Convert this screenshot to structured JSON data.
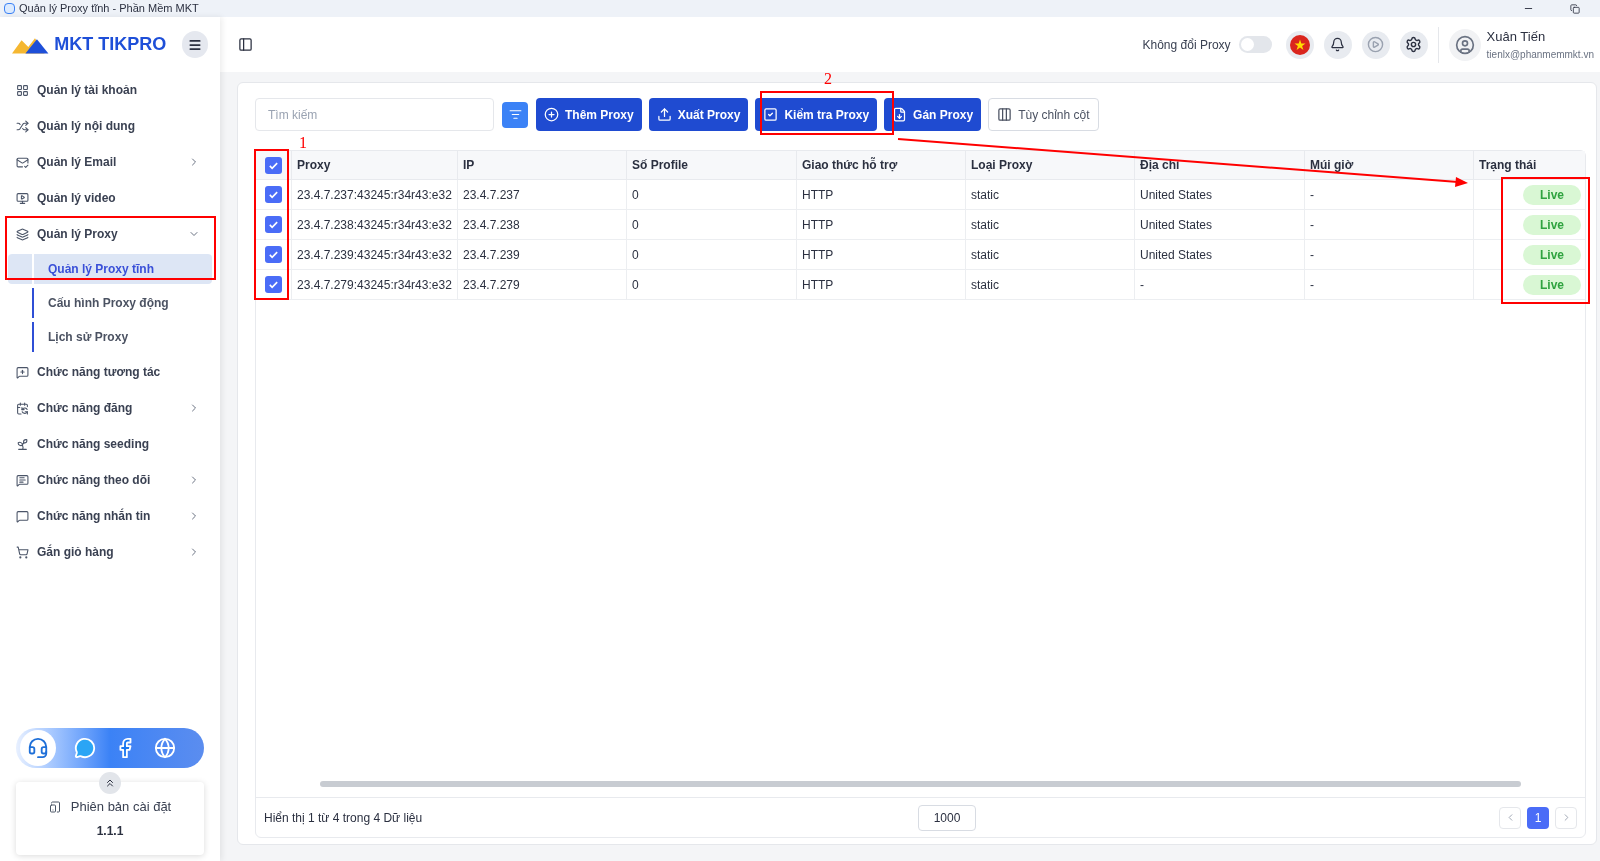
{
  "window": {
    "title": "Quản lý Proxy tĩnh - Phần Mềm MKT"
  },
  "sidebar": {
    "logo": "MKT TIKPRO",
    "items": [
      {
        "label": "Quản lý tài khoản",
        "kind": "link"
      },
      {
        "label": "Quản lý nội dung",
        "kind": "link"
      },
      {
        "label": "Quản lý Email",
        "kind": "group",
        "expanded": false
      },
      {
        "label": "Quản lý video",
        "kind": "link"
      },
      {
        "label": "Quản lý Proxy",
        "kind": "group",
        "expanded": true,
        "children": [
          {
            "label": "Quản lý Proxy tĩnh",
            "selected": true
          },
          {
            "label": "Cấu hình Proxy động",
            "selected": false
          },
          {
            "label": "Lịch sử Proxy",
            "selected": false
          }
        ]
      },
      {
        "label": "Chức năng tương tác",
        "kind": "link"
      },
      {
        "label": "Chức năng đăng",
        "kind": "group",
        "expanded": false
      },
      {
        "label": "Chức năng seeding",
        "kind": "link"
      },
      {
        "label": "Chức năng theo dõi",
        "kind": "group",
        "expanded": false
      },
      {
        "label": "Chức năng nhắn tin",
        "kind": "group",
        "expanded": false
      },
      {
        "label": "Gắn giỏ hàng",
        "kind": "group",
        "expanded": false
      }
    ],
    "version": {
      "label": "Phiên bản cài đặt",
      "value": "1.1.1"
    }
  },
  "header": {
    "toggle": {
      "label": "Không đổi Proxy",
      "on": false
    },
    "user": {
      "name": "Xuân Tiến",
      "email": "tienlx@phanmemmkt.vn"
    }
  },
  "toolbar": {
    "search": {
      "placeholder": "Tìm kiếm"
    },
    "buttons": [
      {
        "label": "Thêm Proxy",
        "kind": "primary"
      },
      {
        "label": "Xuất Proxy",
        "kind": "primary"
      },
      {
        "label": "Kiểm tra Proxy",
        "kind": "primary"
      },
      {
        "label": "Gán Proxy",
        "kind": "primary"
      },
      {
        "label": "Tùy chỉnh cột",
        "kind": "outline"
      }
    ]
  },
  "table": {
    "all_checked": true,
    "columns": [
      "Proxy",
      "IP",
      "Số Profile",
      "Giao thức hỗ trợ",
      "Loại Proxy",
      "Địa chỉ",
      "Múi giờ",
      "Trạng thái"
    ],
    "rows": [
      {
        "checked": true,
        "cells": [
          "23.4.7.237:43245:r34r43:e32",
          "23.4.7.237",
          "0",
          "HTTP",
          "static",
          "United States",
          "-"
        ],
        "status": "Live"
      },
      {
        "checked": true,
        "cells": [
          "23.4.7.238:43245:r34r43:e32",
          "23.4.7.238",
          "0",
          "HTTP",
          "static",
          "United States",
          "-"
        ],
        "status": "Live"
      },
      {
        "checked": true,
        "cells": [
          "23.4.7.239:43245:r34r43:e32",
          "23.4.7.239",
          "0",
          "HTTP",
          "static",
          "United States",
          "-"
        ],
        "status": "Live"
      },
      {
        "checked": true,
        "cells": [
          "23.4.7.279:43245:r34r43:e32",
          "23.4.7.279",
          "0",
          "HTTP",
          "static",
          "-",
          "-"
        ],
        "status": "Live"
      }
    ]
  },
  "footer": {
    "summary": "Hiển thị 1 từ 4 trong 4 Dữ liệu",
    "page_size": "1000",
    "pages": [
      {
        "label": "1",
        "selected": true
      }
    ]
  },
  "annotations": {
    "labels": [
      "1",
      "2"
    ]
  }
}
